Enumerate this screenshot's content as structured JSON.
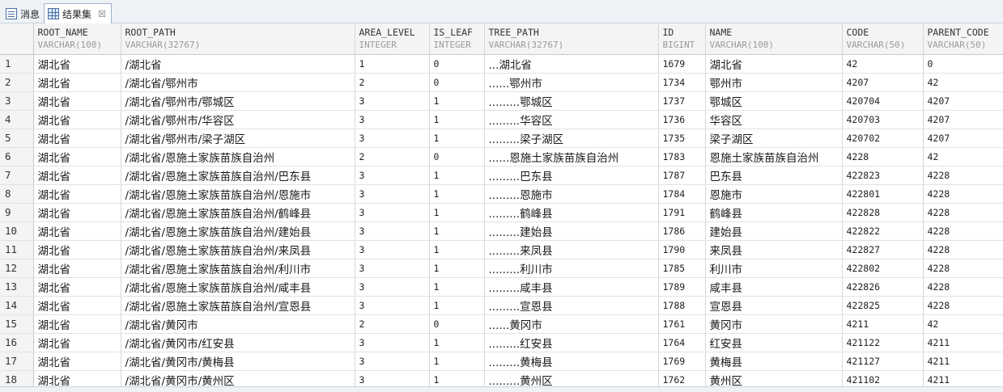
{
  "tabs": [
    {
      "label": "消息",
      "icon": "message-icon"
    },
    {
      "label": "结果集",
      "icon": "grid-icon",
      "close": "☒"
    }
  ],
  "columns": [
    {
      "name": "ROOT_NAME",
      "type": "VARCHAR(100)"
    },
    {
      "name": "ROOT_PATH",
      "type": "VARCHAR(32767)"
    },
    {
      "name": "AREA_LEVEL",
      "type": "INTEGER"
    },
    {
      "name": "IS_LEAF",
      "type": "INTEGER"
    },
    {
      "name": "TREE_PATH",
      "type": "VARCHAR(32767)"
    },
    {
      "name": "ID",
      "type": "BIGINT"
    },
    {
      "name": "NAME",
      "type": "VARCHAR(100)"
    },
    {
      "name": "CODE",
      "type": "VARCHAR(50)"
    },
    {
      "name": "PARENT_CODE",
      "type": "VARCHAR(50)"
    }
  ],
  "rows": [
    [
      "1",
      "湖北省",
      "/湖北省",
      "1",
      "0",
      "...湖北省",
      "1679",
      "湖北省",
      "42",
      "0"
    ],
    [
      "2",
      "湖北省",
      "/湖北省/鄂州市",
      "2",
      "0",
      "......鄂州市",
      "1734",
      "鄂州市",
      "4207",
      "42"
    ],
    [
      "3",
      "湖北省",
      "/湖北省/鄂州市/鄂城区",
      "3",
      "1",
      ".........鄂城区",
      "1737",
      "鄂城区",
      "420704",
      "4207"
    ],
    [
      "4",
      "湖北省",
      "/湖北省/鄂州市/华容区",
      "3",
      "1",
      ".........华容区",
      "1736",
      "华容区",
      "420703",
      "4207"
    ],
    [
      "5",
      "湖北省",
      "/湖北省/鄂州市/梁子湖区",
      "3",
      "1",
      ".........梁子湖区",
      "1735",
      "梁子湖区",
      "420702",
      "4207"
    ],
    [
      "6",
      "湖北省",
      "/湖北省/恩施土家族苗族自治州",
      "2",
      "0",
      "......恩施土家族苗族自治州",
      "1783",
      "恩施土家族苗族自治州",
      "4228",
      "42"
    ],
    [
      "7",
      "湖北省",
      "/湖北省/恩施土家族苗族自治州/巴东县",
      "3",
      "1",
      ".........巴东县",
      "1787",
      "巴东县",
      "422823",
      "4228"
    ],
    [
      "8",
      "湖北省",
      "/湖北省/恩施土家族苗族自治州/恩施市",
      "3",
      "1",
      ".........恩施市",
      "1784",
      "恩施市",
      "422801",
      "4228"
    ],
    [
      "9",
      "湖北省",
      "/湖北省/恩施土家族苗族自治州/鹤峰县",
      "3",
      "1",
      ".........鹤峰县",
      "1791",
      "鹤峰县",
      "422828",
      "4228"
    ],
    [
      "10",
      "湖北省",
      "/湖北省/恩施土家族苗族自治州/建始县",
      "3",
      "1",
      ".........建始县",
      "1786",
      "建始县",
      "422822",
      "4228"
    ],
    [
      "11",
      "湖北省",
      "/湖北省/恩施土家族苗族自治州/来凤县",
      "3",
      "1",
      ".........来凤县",
      "1790",
      "来凤县",
      "422827",
      "4228"
    ],
    [
      "12",
      "湖北省",
      "/湖北省/恩施土家族苗族自治州/利川市",
      "3",
      "1",
      ".........利川市",
      "1785",
      "利川市",
      "422802",
      "4228"
    ],
    [
      "13",
      "湖北省",
      "/湖北省/恩施土家族苗族自治州/咸丰县",
      "3",
      "1",
      ".........咸丰县",
      "1789",
      "咸丰县",
      "422826",
      "4228"
    ],
    [
      "14",
      "湖北省",
      "/湖北省/恩施土家族苗族自治州/宣恩县",
      "3",
      "1",
      ".........宣恩县",
      "1788",
      "宣恩县",
      "422825",
      "4228"
    ],
    [
      "15",
      "湖北省",
      "/湖北省/黄冈市",
      "2",
      "0",
      "......黄冈市",
      "1761",
      "黄冈市",
      "4211",
      "42"
    ],
    [
      "16",
      "湖北省",
      "/湖北省/黄冈市/红安县",
      "3",
      "1",
      ".........红安县",
      "1764",
      "红安县",
      "421122",
      "4211"
    ],
    [
      "17",
      "湖北省",
      "/湖北省/黄冈市/黄梅县",
      "3",
      "1",
      ".........黄梅县",
      "1769",
      "黄梅县",
      "421127",
      "4211"
    ],
    [
      "18",
      "湖北省",
      "/湖北省/黄冈市/黄州区",
      "3",
      "1",
      ".........黄州区",
      "1762",
      "黄州区",
      "421102",
      "4211"
    ]
  ]
}
